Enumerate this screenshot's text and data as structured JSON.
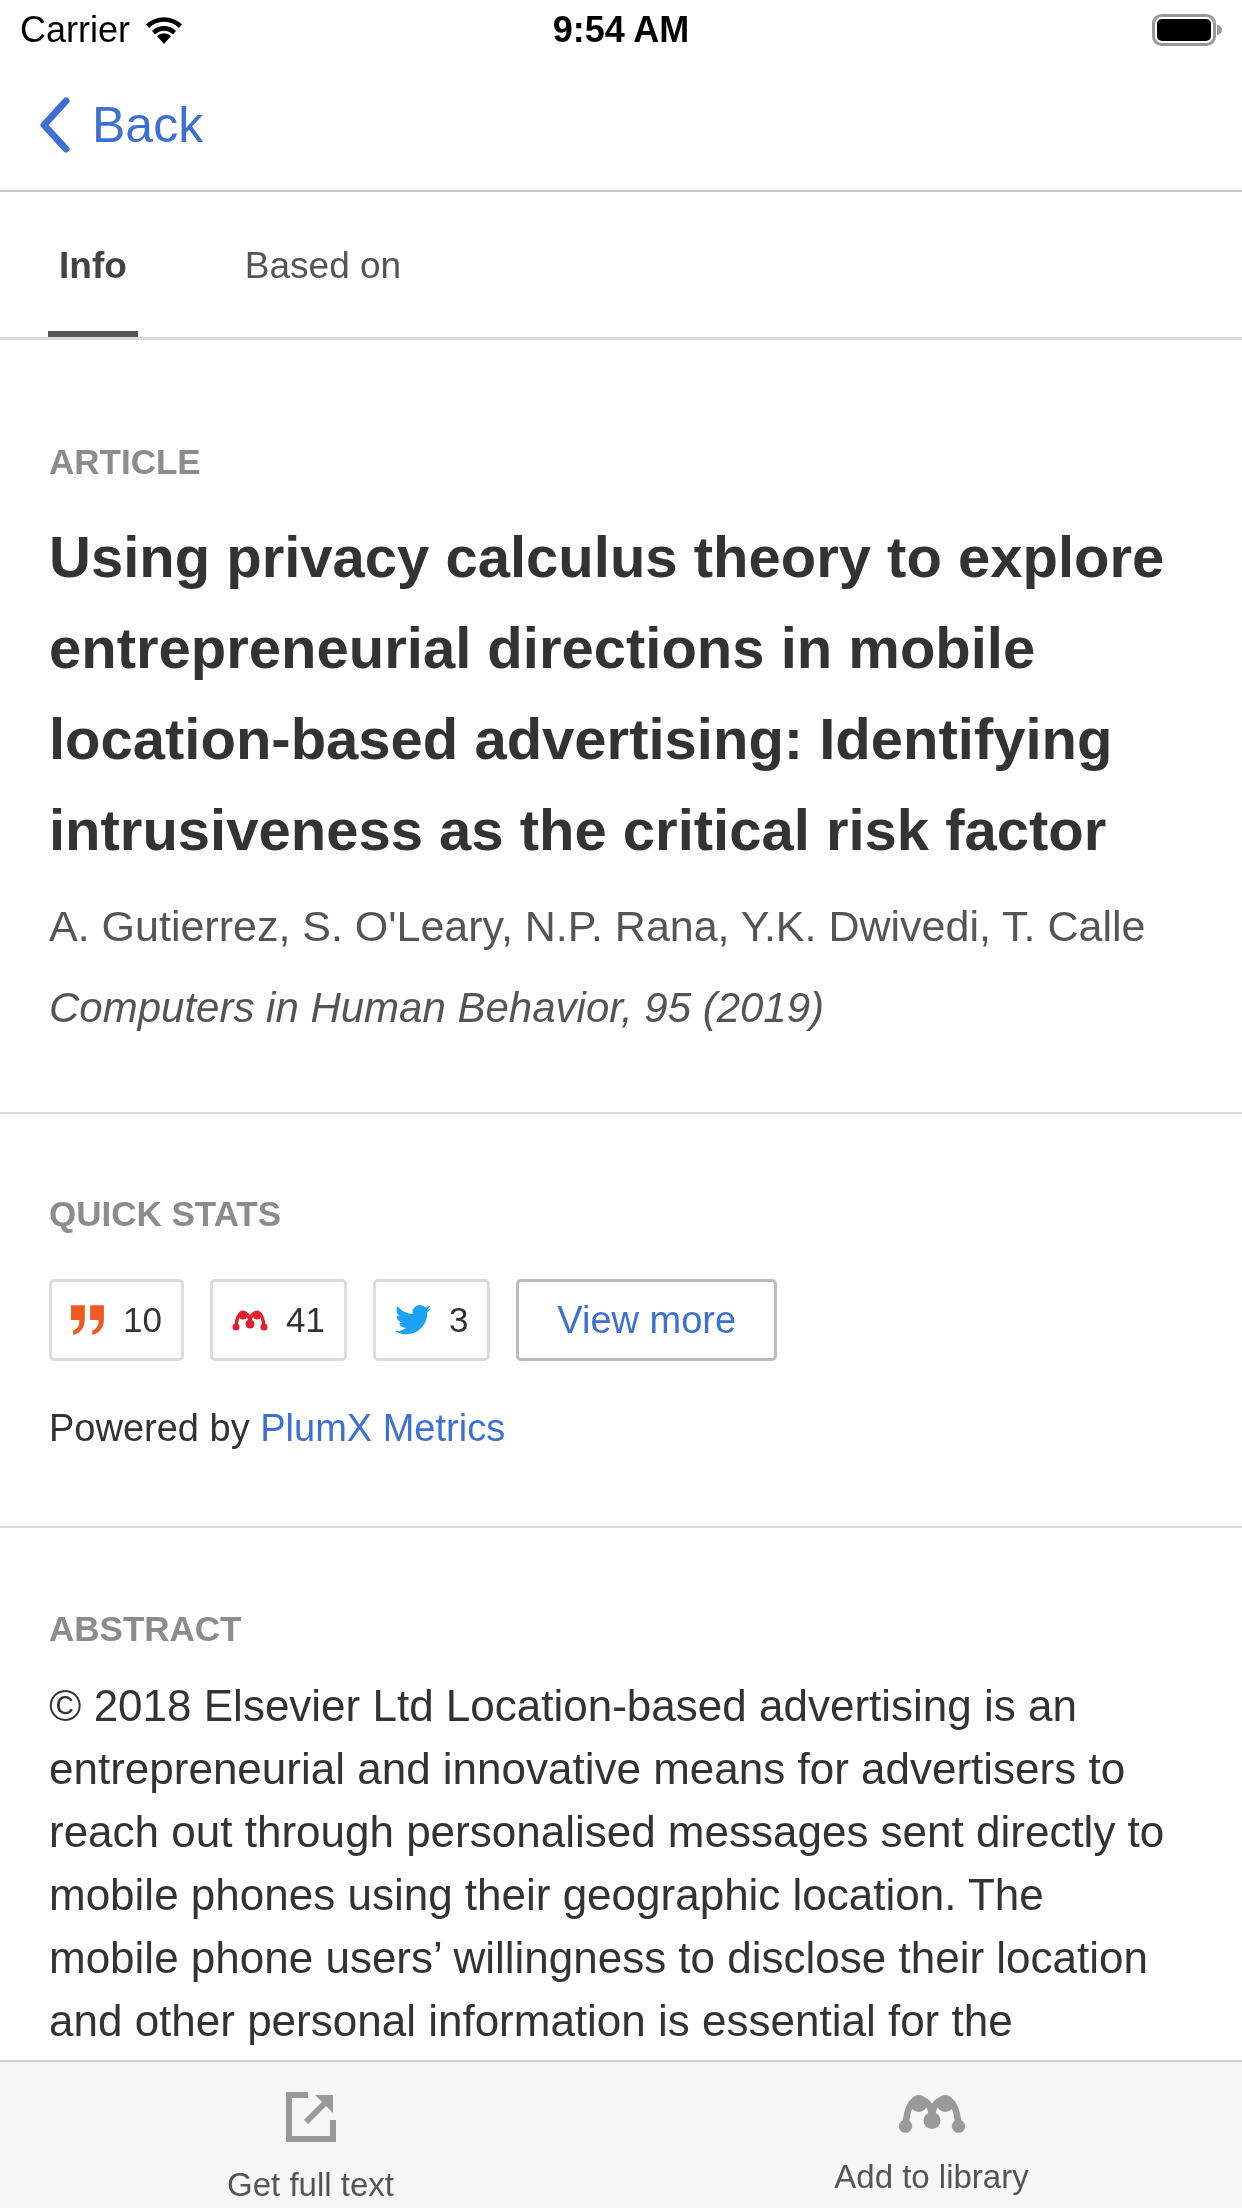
{
  "status_bar": {
    "carrier": "Carrier",
    "time": "9:54 AM"
  },
  "nav_bar": {
    "back": "Back"
  },
  "tabs": [
    {
      "label": "Info",
      "selected": true
    },
    {
      "label": "Based on",
      "selected": false
    }
  ],
  "article": {
    "label": "ARTICLE",
    "title": "Using privacy calculus theory to explore entrepreneurial directions in mobile location-based advertising: Identifying intrusiveness as the critical risk factor",
    "authors": "A. Gutierrez, S. O'Leary, N.P. Rana, Y.K. Dwivedi, T. Calle",
    "journal": "Computers in Human Behavior, 95 (2019)"
  },
  "quick_stats": {
    "label": "QUICK STATS",
    "stats": [
      {
        "kind": "citations",
        "count": "10"
      },
      {
        "kind": "readers",
        "count": "41"
      },
      {
        "kind": "tweets",
        "count": "3"
      }
    ],
    "view_more": "View more",
    "powered_by": "Powered by",
    "powered_link": "PlumX Metrics"
  },
  "abstract": {
    "label": "ABSTRACT",
    "text": "© 2018 Elsevier Ltd Location-based advertising is an entrepreneurial and innovative means for advertisers to reach out through personalised messages sent directly to mobile phones using their geographic location. The mobile phone users’ willingness to disclose their location and other personal information is essential for the"
  },
  "toolbar": [
    {
      "kind": "full_text",
      "label": "Get full text"
    },
    {
      "kind": "library",
      "label": "Add to library"
    }
  ]
}
